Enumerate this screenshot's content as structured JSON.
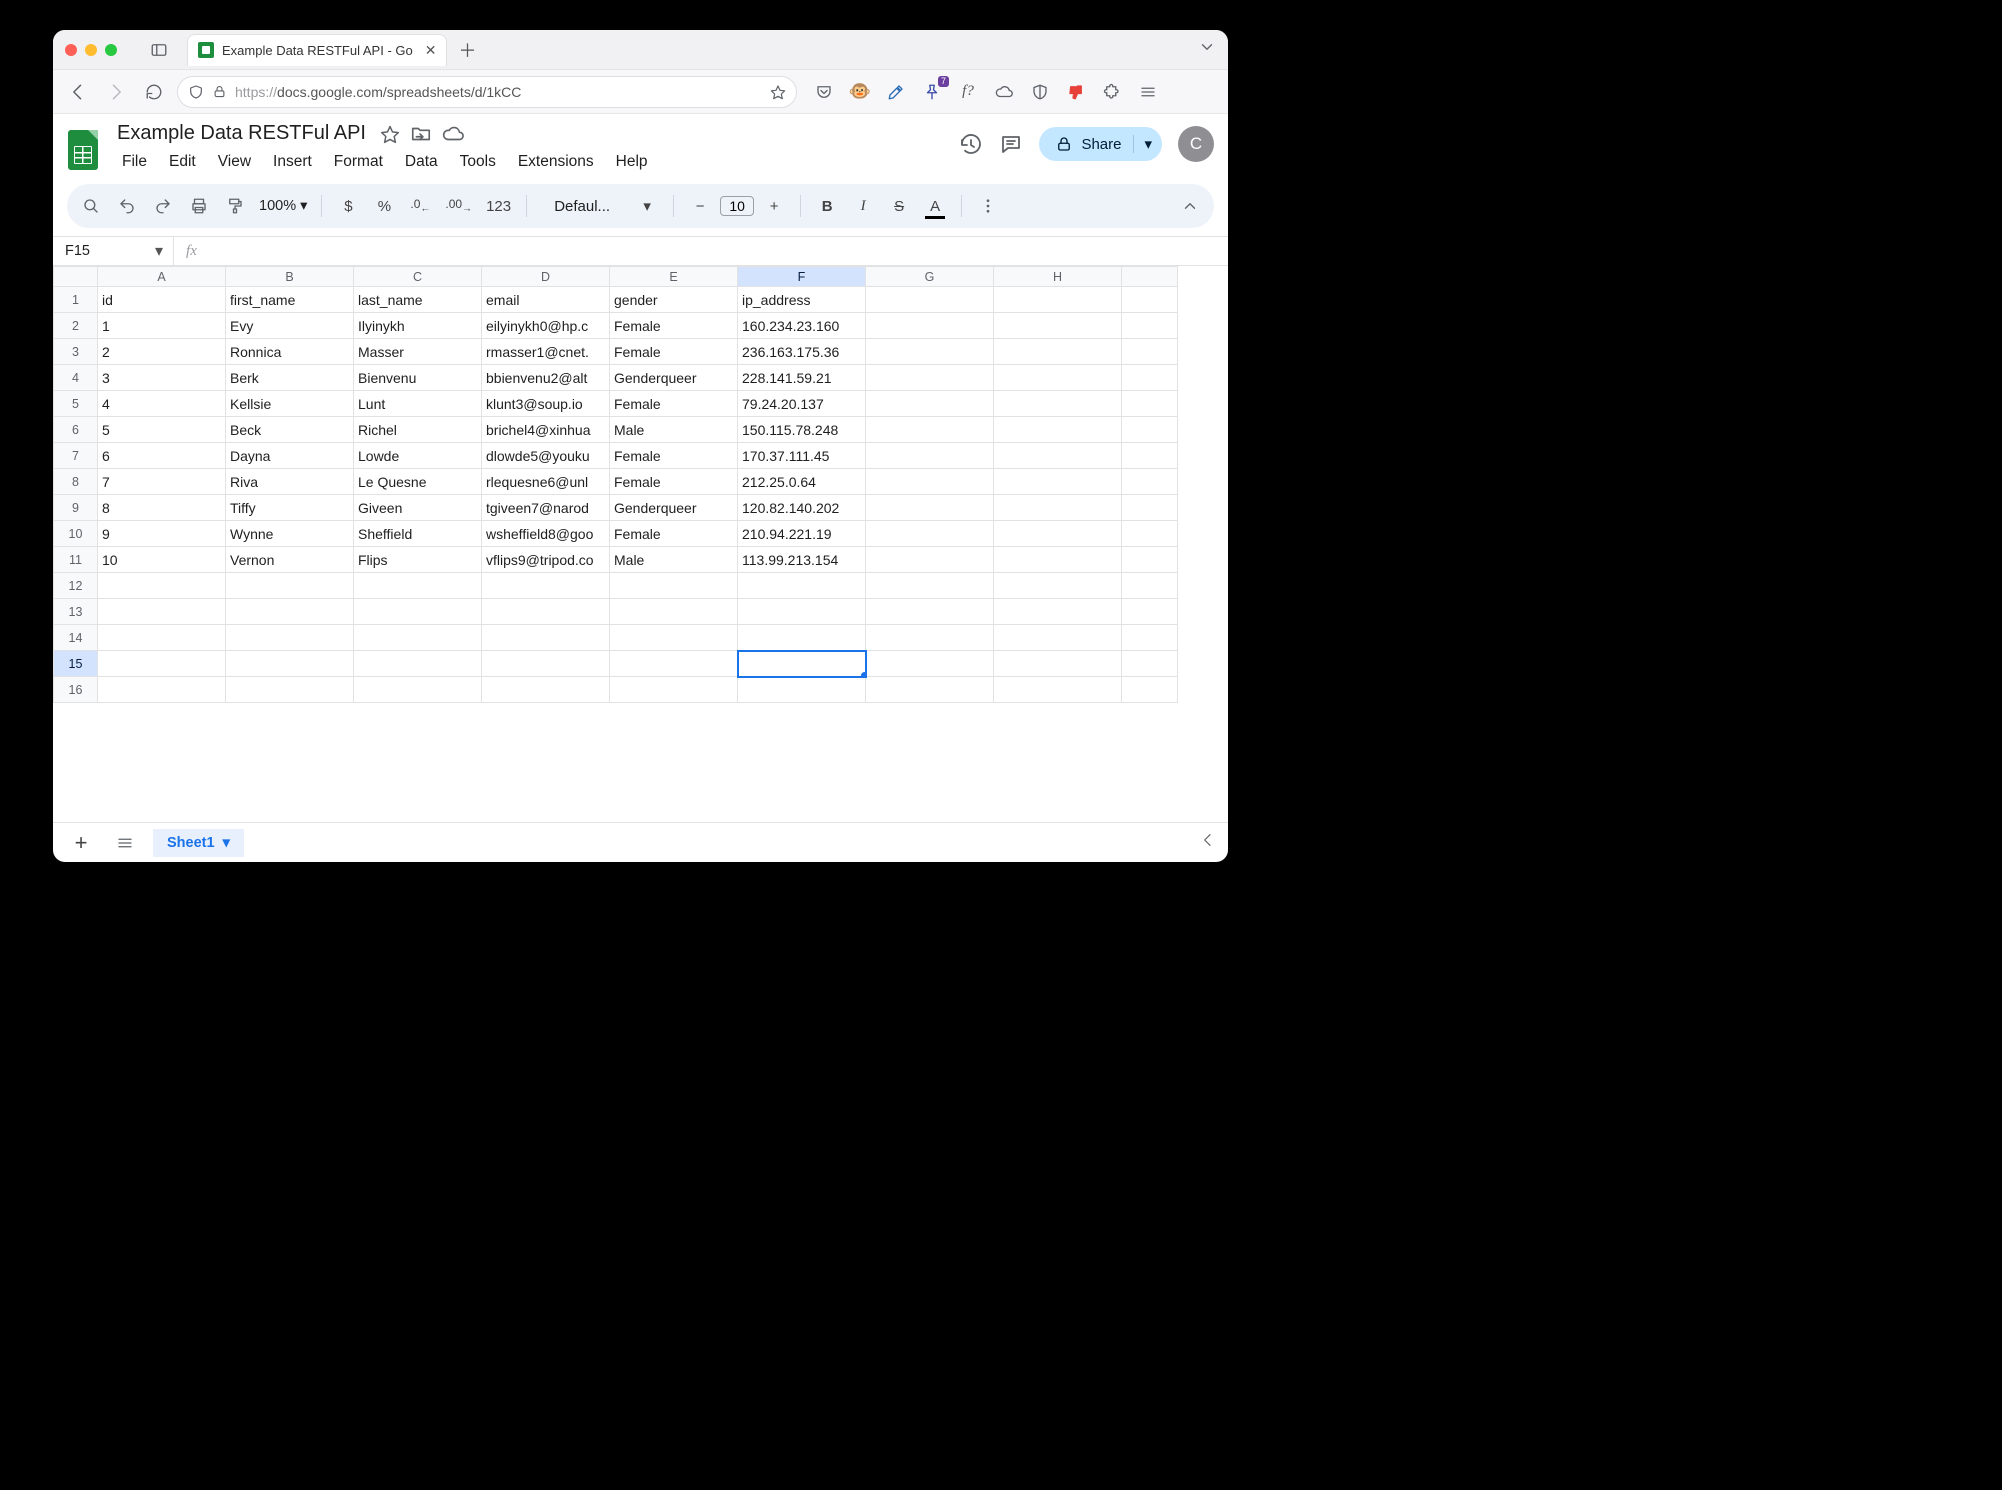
{
  "browser": {
    "tab_title": "Example Data RESTFul API - Go",
    "url_host": "https://",
    "url_rest": "docs.google.com/spreadsheets/d/1kCC",
    "ext_badge": "7",
    "ext_fquestion": "f?"
  },
  "docs": {
    "title": "Example Data RESTFul API",
    "menus": [
      "File",
      "Edit",
      "View",
      "Insert",
      "Format",
      "Data",
      "Tools",
      "Extensions",
      "Help"
    ],
    "share_label": "Share",
    "avatar_letter": "C"
  },
  "toolbar": {
    "zoom": "100%",
    "dollar": "$",
    "percent": "%",
    "dec_decrease": ".0",
    "dec_increase": ".00",
    "format123": "123",
    "font": "Defaul...",
    "font_size": "10",
    "bold": "B",
    "italic": "I",
    "strike": "S",
    "textcolor": "A"
  },
  "fx": {
    "namebox": "F15",
    "fx_label": "fx"
  },
  "grid": {
    "cols": [
      "A",
      "B",
      "C",
      "D",
      "E",
      "F",
      "G",
      "H",
      ""
    ],
    "selected_col": "F",
    "selected_row": 15,
    "headers": [
      "id",
      "first_name",
      "last_name",
      "email",
      "gender",
      "ip_address"
    ],
    "rows": [
      {
        "id": "1",
        "first_name": "Evy",
        "last_name": "Ilyinykh",
        "email": "eilyinykh0@hp.c",
        "gender": "Female",
        "ip": "160.234.23.160"
      },
      {
        "id": "2",
        "first_name": "Ronnica",
        "last_name": "Masser",
        "email": "rmasser1@cnet.",
        "gender": "Female",
        "ip": "236.163.175.36"
      },
      {
        "id": "3",
        "first_name": "Berk",
        "last_name": "Bienvenu",
        "email": "bbienvenu2@alt",
        "gender": "Genderqueer",
        "ip": "228.141.59.21"
      },
      {
        "id": "4",
        "first_name": "Kellsie",
        "last_name": "Lunt",
        "email": "klunt3@soup.io",
        "gender": "Female",
        "ip": "79.24.20.137"
      },
      {
        "id": "5",
        "first_name": "Beck",
        "last_name": "Richel",
        "email": "brichel4@xinhua",
        "gender": "Male",
        "ip": "150.115.78.248"
      },
      {
        "id": "6",
        "first_name": "Dayna",
        "last_name": "Lowde",
        "email": "dlowde5@youku",
        "gender": "Female",
        "ip": "170.37.111.45"
      },
      {
        "id": "7",
        "first_name": "Riva",
        "last_name": "Le Quesne",
        "email": "rlequesne6@unl",
        "gender": "Female",
        "ip": "212.25.0.64"
      },
      {
        "id": "8",
        "first_name": "Tiffy",
        "last_name": "Giveen",
        "email": "tgiveen7@narod",
        "gender": "Genderqueer",
        "ip": "120.82.140.202"
      },
      {
        "id": "9",
        "first_name": "Wynne",
        "last_name": "Sheffield",
        "email": "wsheffield8@goo",
        "gender": "Female",
        "ip": "210.94.221.19"
      },
      {
        "id": "10",
        "first_name": "Vernon",
        "last_name": "Flips",
        "email": "vflips9@tripod.co",
        "gender": "Male",
        "ip": "113.99.213.154"
      }
    ],
    "total_visible_rows": 16
  },
  "sheet_tabs": {
    "name": "Sheet1"
  }
}
